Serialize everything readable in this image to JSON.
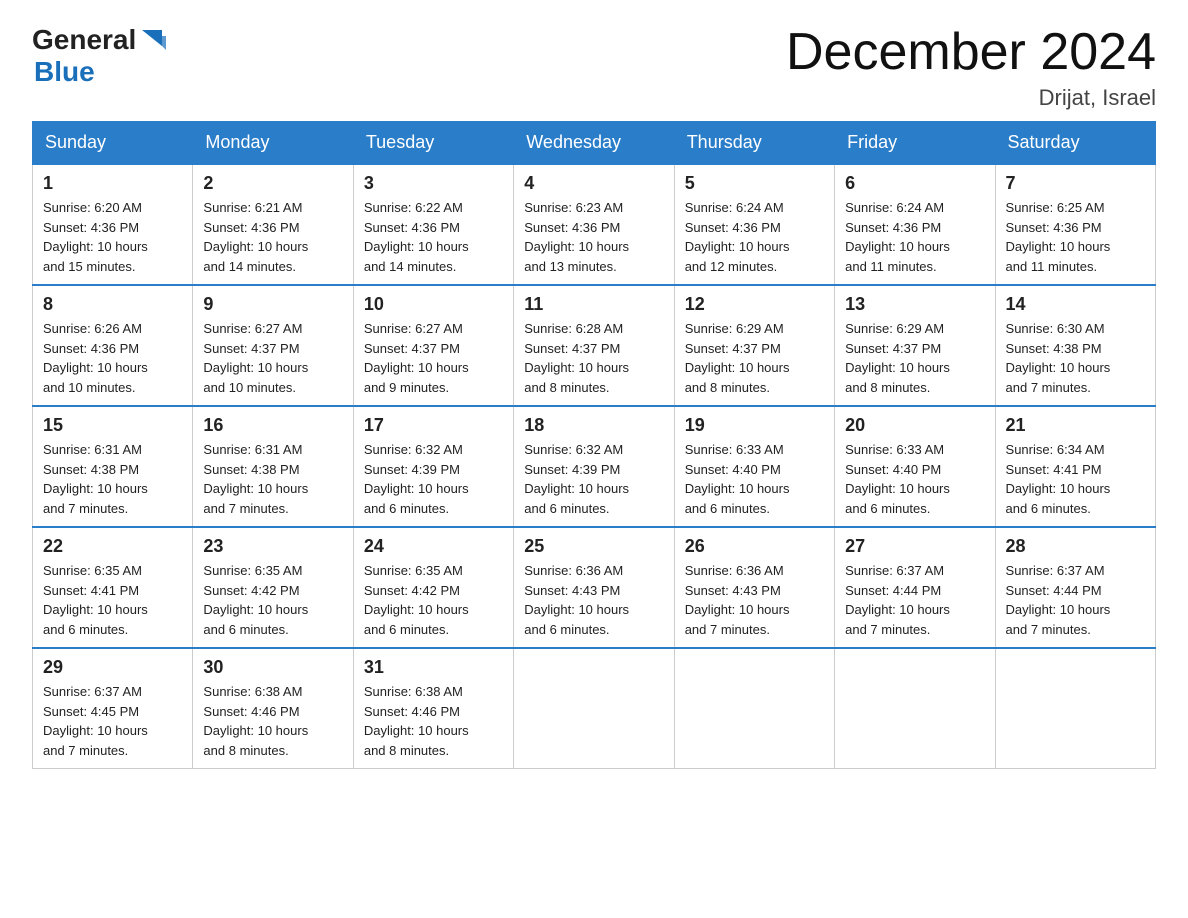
{
  "logo": {
    "general": "General",
    "blue": "Blue"
  },
  "title": {
    "month_year": "December 2024",
    "location": "Drijat, Israel"
  },
  "weekdays": [
    "Sunday",
    "Monday",
    "Tuesday",
    "Wednesday",
    "Thursday",
    "Friday",
    "Saturday"
  ],
  "weeks": [
    [
      {
        "day": "1",
        "sunrise": "6:20 AM",
        "sunset": "4:36 PM",
        "daylight": "10 hours and 15 minutes."
      },
      {
        "day": "2",
        "sunrise": "6:21 AM",
        "sunset": "4:36 PM",
        "daylight": "10 hours and 14 minutes."
      },
      {
        "day": "3",
        "sunrise": "6:22 AM",
        "sunset": "4:36 PM",
        "daylight": "10 hours and 14 minutes."
      },
      {
        "day": "4",
        "sunrise": "6:23 AM",
        "sunset": "4:36 PM",
        "daylight": "10 hours and 13 minutes."
      },
      {
        "day": "5",
        "sunrise": "6:24 AM",
        "sunset": "4:36 PM",
        "daylight": "10 hours and 12 minutes."
      },
      {
        "day": "6",
        "sunrise": "6:24 AM",
        "sunset": "4:36 PM",
        "daylight": "10 hours and 11 minutes."
      },
      {
        "day": "7",
        "sunrise": "6:25 AM",
        "sunset": "4:36 PM",
        "daylight": "10 hours and 11 minutes."
      }
    ],
    [
      {
        "day": "8",
        "sunrise": "6:26 AM",
        "sunset": "4:36 PM",
        "daylight": "10 hours and 10 minutes."
      },
      {
        "day": "9",
        "sunrise": "6:27 AM",
        "sunset": "4:37 PM",
        "daylight": "10 hours and 10 minutes."
      },
      {
        "day": "10",
        "sunrise": "6:27 AM",
        "sunset": "4:37 PM",
        "daylight": "10 hours and 9 minutes."
      },
      {
        "day": "11",
        "sunrise": "6:28 AM",
        "sunset": "4:37 PM",
        "daylight": "10 hours and 8 minutes."
      },
      {
        "day": "12",
        "sunrise": "6:29 AM",
        "sunset": "4:37 PM",
        "daylight": "10 hours and 8 minutes."
      },
      {
        "day": "13",
        "sunrise": "6:29 AM",
        "sunset": "4:37 PM",
        "daylight": "10 hours and 8 minutes."
      },
      {
        "day": "14",
        "sunrise": "6:30 AM",
        "sunset": "4:38 PM",
        "daylight": "10 hours and 7 minutes."
      }
    ],
    [
      {
        "day": "15",
        "sunrise": "6:31 AM",
        "sunset": "4:38 PM",
        "daylight": "10 hours and 7 minutes."
      },
      {
        "day": "16",
        "sunrise": "6:31 AM",
        "sunset": "4:38 PM",
        "daylight": "10 hours and 7 minutes."
      },
      {
        "day": "17",
        "sunrise": "6:32 AM",
        "sunset": "4:39 PM",
        "daylight": "10 hours and 6 minutes."
      },
      {
        "day": "18",
        "sunrise": "6:32 AM",
        "sunset": "4:39 PM",
        "daylight": "10 hours and 6 minutes."
      },
      {
        "day": "19",
        "sunrise": "6:33 AM",
        "sunset": "4:40 PM",
        "daylight": "10 hours and 6 minutes."
      },
      {
        "day": "20",
        "sunrise": "6:33 AM",
        "sunset": "4:40 PM",
        "daylight": "10 hours and 6 minutes."
      },
      {
        "day": "21",
        "sunrise": "6:34 AM",
        "sunset": "4:41 PM",
        "daylight": "10 hours and 6 minutes."
      }
    ],
    [
      {
        "day": "22",
        "sunrise": "6:35 AM",
        "sunset": "4:41 PM",
        "daylight": "10 hours and 6 minutes."
      },
      {
        "day": "23",
        "sunrise": "6:35 AM",
        "sunset": "4:42 PM",
        "daylight": "10 hours and 6 minutes."
      },
      {
        "day": "24",
        "sunrise": "6:35 AM",
        "sunset": "4:42 PM",
        "daylight": "10 hours and 6 minutes."
      },
      {
        "day": "25",
        "sunrise": "6:36 AM",
        "sunset": "4:43 PM",
        "daylight": "10 hours and 6 minutes."
      },
      {
        "day": "26",
        "sunrise": "6:36 AM",
        "sunset": "4:43 PM",
        "daylight": "10 hours and 7 minutes."
      },
      {
        "day": "27",
        "sunrise": "6:37 AM",
        "sunset": "4:44 PM",
        "daylight": "10 hours and 7 minutes."
      },
      {
        "day": "28",
        "sunrise": "6:37 AM",
        "sunset": "4:44 PM",
        "daylight": "10 hours and 7 minutes."
      }
    ],
    [
      {
        "day": "29",
        "sunrise": "6:37 AM",
        "sunset": "4:45 PM",
        "daylight": "10 hours and 7 minutes."
      },
      {
        "day": "30",
        "sunrise": "6:38 AM",
        "sunset": "4:46 PM",
        "daylight": "10 hours and 8 minutes."
      },
      {
        "day": "31",
        "sunrise": "6:38 AM",
        "sunset": "4:46 PM",
        "daylight": "10 hours and 8 minutes."
      },
      null,
      null,
      null,
      null
    ]
  ],
  "labels": {
    "sunrise": "Sunrise:",
    "sunset": "Sunset:",
    "daylight": "Daylight:"
  }
}
